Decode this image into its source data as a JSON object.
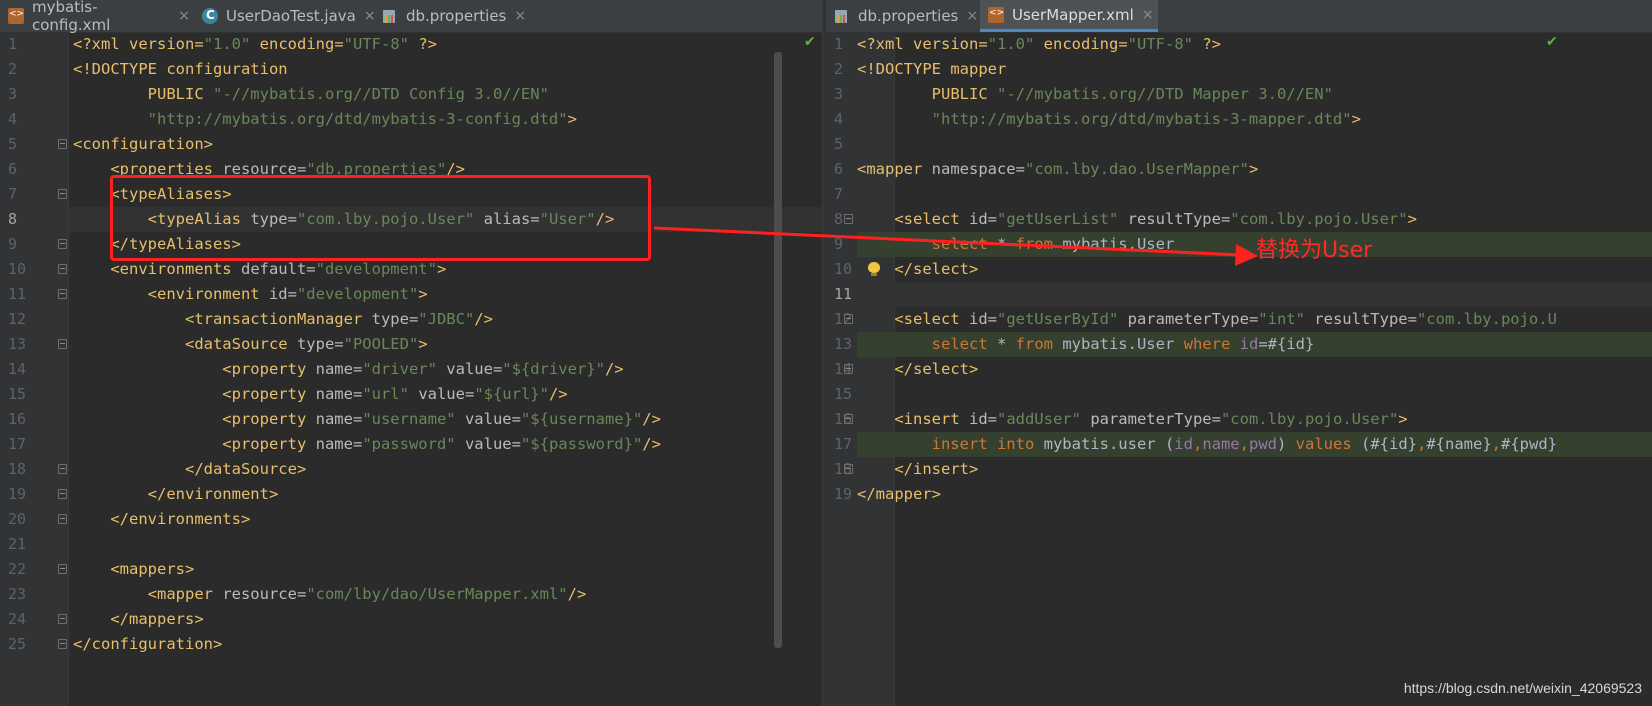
{
  "left_pane": {
    "tabs": [
      {
        "label": "mybatis-config.xml",
        "icon": "xml-file-icon",
        "active": false
      },
      {
        "label": "UserDaoTest.java",
        "icon": "java-class-icon",
        "active": false
      },
      {
        "label": "db.properties",
        "icon": "properties-file-icon",
        "active": false
      }
    ],
    "close_glyph": "×",
    "line_numbers": [
      "1",
      "2",
      "3",
      "4",
      "5",
      "6",
      "7",
      "8",
      "9",
      "10",
      "11",
      "12",
      "13",
      "14",
      "15",
      "16",
      "17",
      "18",
      "19",
      "20",
      "21",
      "22",
      "23",
      "24",
      "25"
    ],
    "code": {
      "l1": [
        "<?xml version=",
        "\"1.0\"",
        " encoding=",
        "\"UTF-8\"",
        " ?>"
      ],
      "l2": [
        "<!DOCTYPE configuration"
      ],
      "l3": [
        "        PUBLIC ",
        "\"-//mybatis.org//DTD Config 3.0//EN\""
      ],
      "l4": [
        "        ",
        "\"http://mybatis.org/dtd/mybatis-3-config.dtd\"",
        ">"
      ],
      "l5": [
        "<configuration>"
      ],
      "l6": [
        "    <properties ",
        "resource=",
        "\"db.properties\"",
        "/>"
      ],
      "l7": [
        "    <typeAliases>"
      ],
      "l8": [
        "        <typeAlias ",
        "type=",
        "\"com.lby.pojo.User\"",
        " alias=",
        "\"User\"",
        "/>"
      ],
      "l9": [
        "    </typeAliases>"
      ],
      "l10": [
        "    <environments ",
        "default=",
        "\"development\"",
        ">"
      ],
      "l11": [
        "        <environment ",
        "id=",
        "\"development\"",
        ">"
      ],
      "l12": [
        "            <transactionManager ",
        "type=",
        "\"JDBC\"",
        "/>"
      ],
      "l13": [
        "            <dataSource ",
        "type=",
        "\"POOLED\"",
        ">"
      ],
      "l14": [
        "                <property ",
        "name=",
        "\"driver\"",
        " value=",
        "\"${driver}\"",
        "/>"
      ],
      "l15": [
        "                <property ",
        "name=",
        "\"url\"",
        " value=",
        "\"${url}\"",
        "/>"
      ],
      "l16": [
        "                <property ",
        "name=",
        "\"username\"",
        " value=",
        "\"${username}\"",
        "/>"
      ],
      "l17": [
        "                <property ",
        "name=",
        "\"password\"",
        " value=",
        "\"${password}\"",
        "/>"
      ],
      "l18": [
        "            </dataSource>"
      ],
      "l19": [
        "        </environment>"
      ],
      "l20": [
        "    </environments>"
      ],
      "l21": [
        ""
      ],
      "l22": [
        "    <mappers>"
      ],
      "l23": [
        "        <mapper ",
        "resource=",
        "\"com/lby/dao/UserMapper.xml\"",
        "/>"
      ],
      "l24": [
        "    </mappers>"
      ],
      "l25": [
        "</configuration>"
      ]
    }
  },
  "right_pane": {
    "tabs": [
      {
        "label": "db.properties",
        "icon": "properties-file-icon",
        "active": false
      },
      {
        "label": "UserMapper.xml",
        "icon": "xml-file-icon",
        "active": true
      }
    ],
    "close_glyph": "×",
    "line_numbers": [
      "1",
      "2",
      "3",
      "4",
      "5",
      "6",
      "7",
      "8",
      "9",
      "10",
      "11",
      "12",
      "13",
      "14",
      "15",
      "16",
      "17",
      "18",
      "19"
    ],
    "code": {
      "l1": [
        "<?xml version=",
        "\"1.0\"",
        " encoding=",
        "\"UTF-8\"",
        " ?>"
      ],
      "l2": [
        "<!DOCTYPE mapper"
      ],
      "l3": [
        "        PUBLIC ",
        "\"-//mybatis.org//DTD Mapper 3.0//EN\""
      ],
      "l4": [
        "        ",
        "\"http://mybatis.org/dtd/mybatis-3-mapper.dtd\"",
        ">"
      ],
      "l5": [
        ""
      ],
      "l6": [
        "<mapper ",
        "namespace=",
        "\"com.lby.dao.UserMapper\"",
        ">"
      ],
      "l7": [
        ""
      ],
      "l8": [
        "    <select ",
        "id=",
        "\"getUserList\"",
        " resultType=",
        "\"com.lby.pojo.User\"",
        ">"
      ],
      "l9": [
        "        ",
        "select",
        " * ",
        "from",
        " mybatis.User"
      ],
      "l10": [
        "    </select>"
      ],
      "l11": [
        ""
      ],
      "l12": [
        "    <select ",
        "id=",
        "\"getUserById\"",
        " parameterType=",
        "\"int\"",
        " resultType=",
        "\"com.lby.pojo.U"
      ],
      "l13": [
        "        ",
        "select",
        " * ",
        "from",
        " mybatis.User ",
        "where",
        " ",
        "id",
        "=#{id}"
      ],
      "l14": [
        "    </select>"
      ],
      "l15": [
        ""
      ],
      "l16": [
        "    <insert ",
        "id=",
        "\"addUser\"",
        " parameterType=",
        "\"com.lby.pojo.User\"",
        ">"
      ],
      "l17": [
        "        ",
        "insert into",
        " mybatis.user (",
        "id",
        ",",
        "name",
        ",",
        "pwd",
        ") ",
        "values",
        " (#{id}",
        ",",
        "#{name}",
        ",",
        "#{pwd}"
      ],
      "l18": [
        "    </insert>"
      ],
      "l19": [
        "</mapper>"
      ]
    }
  },
  "annotation": {
    "text": "替换为User",
    "color": "#ff2a2a"
  },
  "watermark": "https://blog.csdn.net/weixin_42069523",
  "colors": {
    "background": "#2b2b2b",
    "tag": "#e8bf6a",
    "string": "#6a8759",
    "keyword": "#cc7832",
    "annotation_red": "#ff2020"
  }
}
